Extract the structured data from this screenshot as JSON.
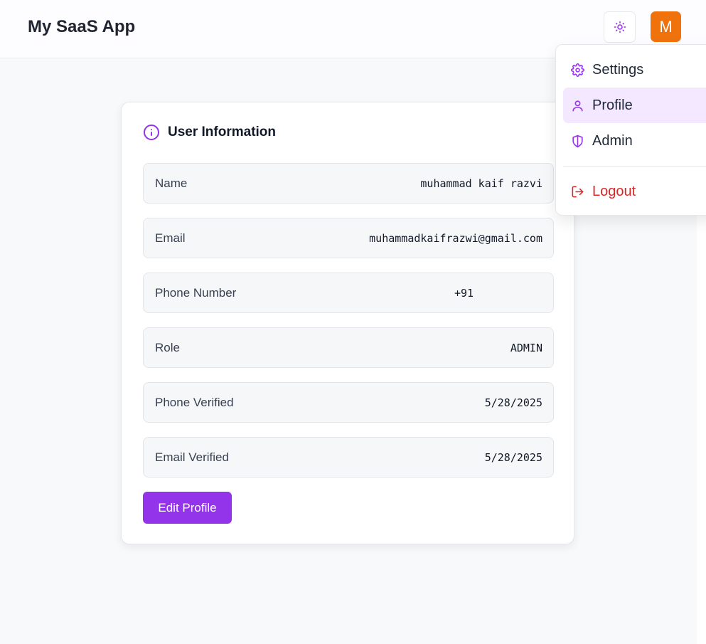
{
  "header": {
    "title": "My SaaS App",
    "theme_icon": "sun-icon",
    "avatar_letter": "M"
  },
  "card": {
    "title": "User Information",
    "icon": "info-icon",
    "rows": [
      {
        "label": "Name",
        "value": "muhammad kaif razvi"
      },
      {
        "label": "Email",
        "value": "muhammadkaifrazwi@gmail.com"
      },
      {
        "label": "Phone Number",
        "value": "+91"
      },
      {
        "label": "Role",
        "value": "ADMIN"
      },
      {
        "label": "Phone Verified",
        "value": "5/28/2025"
      },
      {
        "label": "Email Verified",
        "value": "5/28/2025"
      }
    ],
    "edit_button": "Edit Profile"
  },
  "menu": {
    "items": [
      {
        "label": "Settings",
        "icon": "gear-icon"
      },
      {
        "label": "Profile",
        "icon": "user-icon",
        "active": true
      },
      {
        "label": "Admin",
        "icon": "shield-icon"
      },
      {
        "label": "Logout",
        "icon": "logout-icon"
      }
    ]
  },
  "colors": {
    "accent": "#9333ea",
    "avatar": "#f0720c",
    "danger": "#dc2626",
    "active_bg": "#f3e8ff"
  }
}
